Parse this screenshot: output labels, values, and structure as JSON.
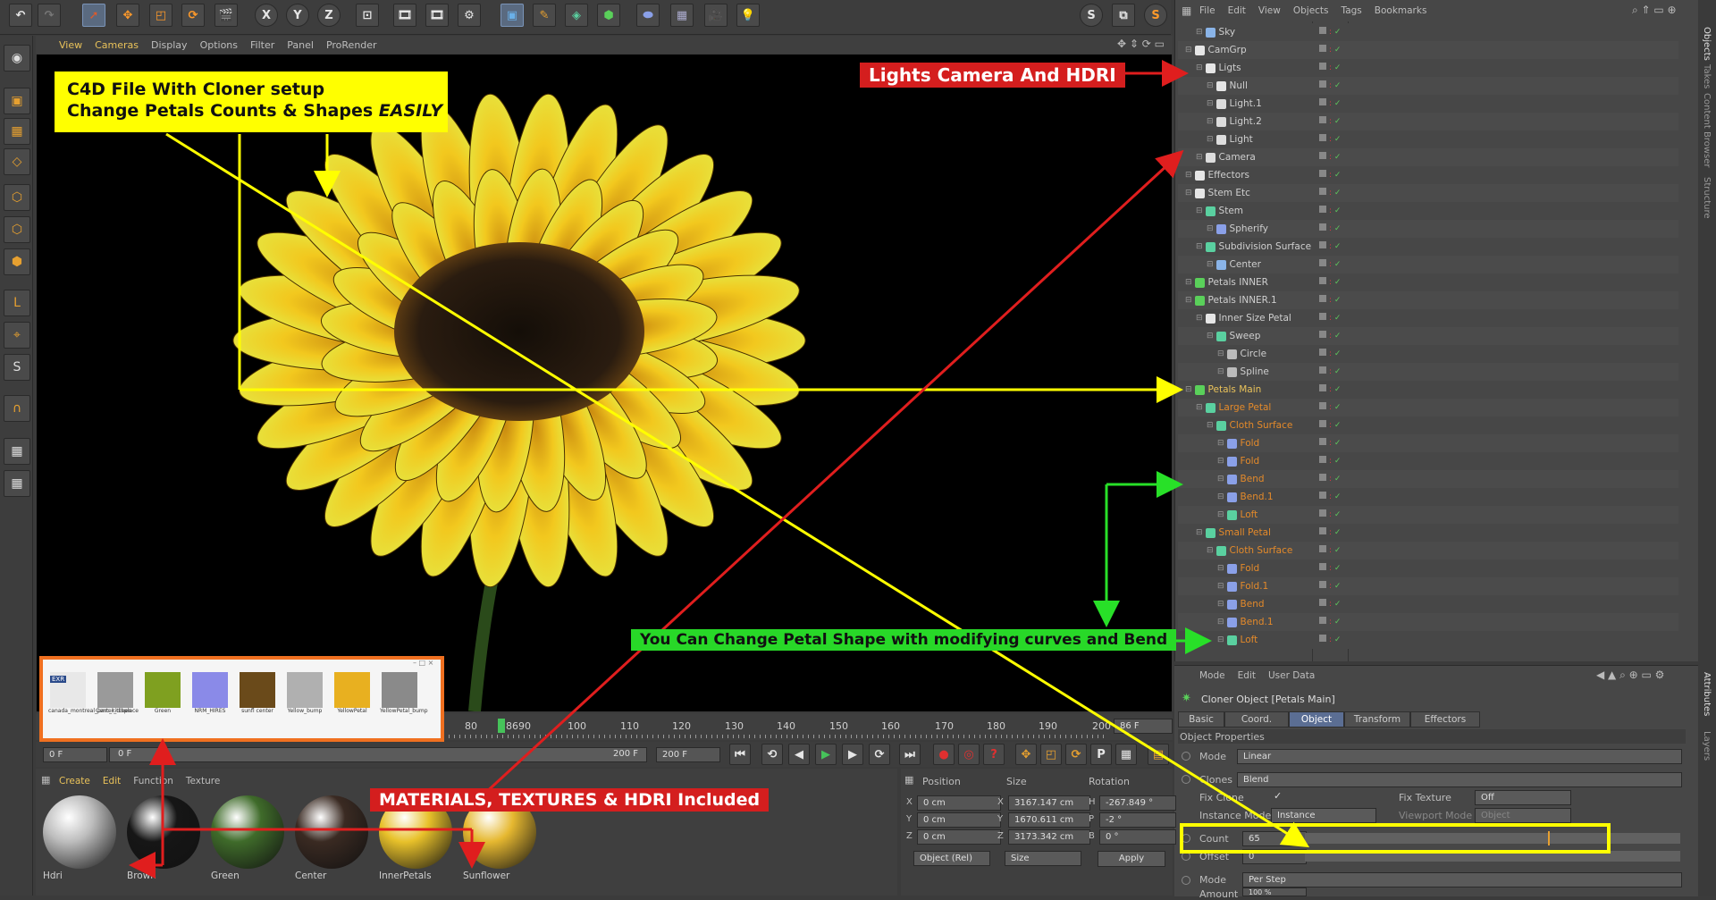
{
  "toolbar": {
    "axis_buttons": [
      "X",
      "Y",
      "Z"
    ],
    "icons": [
      "undo-icon",
      "redo-icon",
      "select-icon",
      "move-icon",
      "scale-icon",
      "rotate-icon",
      "render-view-icon",
      "x-axis-icon",
      "y-axis-icon",
      "z-axis-icon",
      "world-coords-icon",
      "render-region-icon",
      "render-to-picture-viewer-icon",
      "render-settings-icon",
      "cube-icon",
      "pen-icon",
      "subdivision-icon",
      "array-icon",
      "deformer-icon",
      "floor-icon",
      "camera-icon",
      "light-icon"
    ]
  },
  "viewport": {
    "menu": [
      "View",
      "Cameras",
      "Display",
      "Options",
      "Filter",
      "Panel",
      "ProRender"
    ]
  },
  "callouts": {
    "cloner": {
      "line1": "C4D File With Cloner setup",
      "line2": "Change Petals Counts & Shapes ",
      "line2_em": "EASILY"
    },
    "lights": "Lights Camera And HDRI",
    "petal_shape": "You Can Change Petal Shape with modifying curves and Bend",
    "materials": "MATERIALS, TEXTURES & HDRI Included"
  },
  "object_manager": {
    "menu": [
      "File",
      "Edit",
      "View",
      "Objects",
      "Tags",
      "Bookmarks"
    ],
    "rows": [
      {
        "label": "Sky",
        "indent": 1
      },
      {
        "label": "CamGrp",
        "indent": 0
      },
      {
        "label": "Ligts",
        "indent": 1
      },
      {
        "label": "Null",
        "indent": 2
      },
      {
        "label": "Light.1",
        "indent": 2
      },
      {
        "label": "Light.2",
        "indent": 2
      },
      {
        "label": "Light",
        "indent": 2
      },
      {
        "label": "Camera",
        "indent": 1
      },
      {
        "label": "Effectors",
        "indent": 0
      },
      {
        "label": "Stem Etc",
        "indent": 0
      },
      {
        "label": "Stem",
        "indent": 1
      },
      {
        "label": "Spherify",
        "indent": 2
      },
      {
        "label": "Subdivision Surface",
        "indent": 1
      },
      {
        "label": "Center",
        "indent": 2
      },
      {
        "label": "Petals INNER",
        "indent": 0
      },
      {
        "label": "Petals INNER.1",
        "indent": 0
      },
      {
        "label": "Inner Size Petal",
        "indent": 1
      },
      {
        "label": "Sweep",
        "indent": 2
      },
      {
        "label": "Circle",
        "indent": 3
      },
      {
        "label": "Spline",
        "indent": 3
      },
      {
        "label": "Petals Main",
        "indent": 0,
        "state": "sel"
      },
      {
        "label": "Large Petal",
        "indent": 1,
        "state": "org"
      },
      {
        "label": "Cloth Surface",
        "indent": 2,
        "state": "org"
      },
      {
        "label": "Fold",
        "indent": 3,
        "state": "org"
      },
      {
        "label": "Fold",
        "indent": 3,
        "state": "org"
      },
      {
        "label": "Bend",
        "indent": 3,
        "state": "org"
      },
      {
        "label": "Bend.1",
        "indent": 3,
        "state": "org"
      },
      {
        "label": "Loft",
        "indent": 3,
        "state": "org"
      },
      {
        "label": "Small Petal",
        "indent": 1,
        "state": "org"
      },
      {
        "label": "Cloth Surface",
        "indent": 2,
        "state": "org"
      },
      {
        "label": "Fold",
        "indent": 3,
        "state": "org"
      },
      {
        "label": "Fold.1",
        "indent": 3,
        "state": "org"
      },
      {
        "label": "Bend",
        "indent": 3,
        "state": "org"
      },
      {
        "label": "Bend.1",
        "indent": 3,
        "state": "org"
      },
      {
        "label": "Loft",
        "indent": 3,
        "state": "org"
      }
    ]
  },
  "side_tabs": {
    "top": [
      "Objects",
      "Takes",
      "Content Browser",
      "Structure"
    ],
    "bottom": [
      "Attributes",
      "Layers"
    ]
  },
  "attributes": {
    "menu": [
      "Mode",
      "Edit",
      "User Data"
    ],
    "title": "Cloner Object [Petals Main]",
    "tabs": [
      "Basic",
      "Coord.",
      "Object",
      "Transform",
      "Effectors"
    ],
    "active_tab": "Object",
    "section": "Object Properties",
    "mode_label": "Mode",
    "mode_value": "Linear",
    "clones_label": "Clones",
    "clones_value": "Blend",
    "fix_clone_label": "Fix Clone",
    "fix_clone_check": "✓",
    "fix_texture_label": "Fix Texture",
    "fix_texture_value": "Off",
    "instance_mode_label": "Instance Mode",
    "instance_mode_value": "Instance",
    "viewport_mode_label": "Viewport Mode",
    "viewport_mode_value": "Object",
    "count_label": "Count",
    "count_value": "65",
    "offset_label": "Offset",
    "offset_value": "0",
    "mode2_label": "Mode",
    "mode2_value": "Per Step",
    "amount_label": "Amount",
    "amount_value": "100 %"
  },
  "timeline": {
    "ticks": [
      "80",
      "8690",
      "100",
      "110",
      "120",
      "130",
      "140",
      "150",
      "160",
      "170",
      "180",
      "190",
      "200"
    ],
    "current_frame": "86 F",
    "start": "0 F",
    "start2": "0 F",
    "end": "200 F",
    "end2": "200 F"
  },
  "material_manager": {
    "menu": [
      "Create",
      "Edit",
      "Function",
      "Texture"
    ],
    "materials": [
      {
        "name": "Hdri",
        "color": "#bdbdbd"
      },
      {
        "name": "Brown",
        "color": "#161616"
      },
      {
        "name": "Green",
        "color": "#3f6b2a"
      },
      {
        "name": "Center",
        "color": "#3a2a22"
      },
      {
        "name": "InnerPetals",
        "color": "#e8c12a"
      },
      {
        "name": "Sunflower",
        "color": "#e6b830"
      }
    ]
  },
  "coord_manager": {
    "headers": [
      "Position",
      "Size",
      "Rotation"
    ],
    "rows": [
      {
        "axis": "X",
        "pos": "0 cm",
        "sax": "X",
        "size": "3167.147 cm",
        "rax": "H",
        "rot": "-267.849 °"
      },
      {
        "axis": "Y",
        "pos": "0 cm",
        "sax": "Y",
        "size": "1670.611 cm",
        "rax": "P",
        "rot": "-2 °"
      },
      {
        "axis": "Z",
        "pos": "0 cm",
        "sax": "Z",
        "size": "3173.342 cm",
        "rax": "B",
        "rot": "0 °"
      }
    ],
    "mode": "Object (Rel)",
    "size_mode": "Size",
    "apply": "Apply"
  },
  "texture_window": {
    "thumbs": [
      {
        "name": "canada_montreal_parc_kitchen",
        "color": "#e8e8e8",
        "badge": "EXR"
      },
      {
        "name": "Center_displace",
        "color": "#9a9a9a"
      },
      {
        "name": "Green",
        "color": "#7fa020"
      },
      {
        "name": "NRM_HIRES",
        "color": "#8a8ae8"
      },
      {
        "name": "sunfl center",
        "color": "#6a4a1a"
      },
      {
        "name": "Yellow_bump",
        "color": "#b0b0b0"
      },
      {
        "name": "YellowPetal",
        "color": "#e8b020"
      },
      {
        "name": "YellowPetal_bump",
        "color": "#8a8a8a"
      }
    ]
  },
  "colors": {
    "callout_yellow": "#ffff00",
    "callout_red": "#d41e1e",
    "callout_green": "#28e028",
    "selected_label": "#e9c25a",
    "orange_label": "#e48a2a",
    "active_tab": "#5b6e93"
  }
}
